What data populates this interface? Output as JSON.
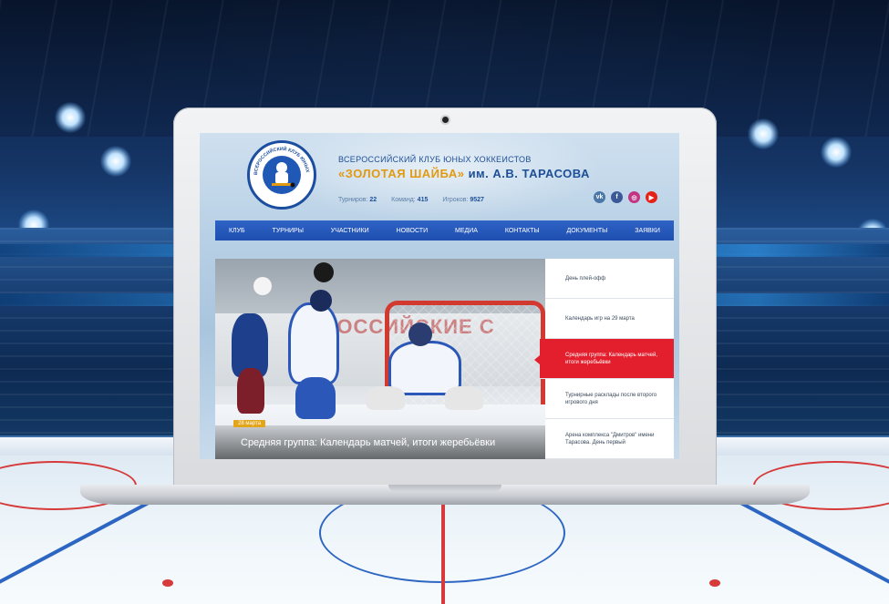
{
  "colors": {
    "nav_blue": "#2459bd",
    "brand_gold": "#e09a12",
    "brand_blue": "#1d4f97",
    "active_red": "#e31e2d",
    "date_badge": "#e3a51a"
  },
  "header": {
    "logo_text": "ВСЕРОССИЙСКИЙ КЛУБ ЮНЫХ ХОККЕИСТОВ «ЗОЛОТАЯ ШАЙБА»",
    "org_line1": "ВСЕРОССИЙСКИЙ КЛУБ ЮНЫХ ХОККЕИСТОВ",
    "org_name_quoted": "«ЗОЛОТАЯ ШАЙБА»",
    "org_name_rest": " им. А.В. ТАРАСОВА",
    "stats": [
      {
        "label": "Турниров:",
        "value": "22"
      },
      {
        "label": "Команд:",
        "value": "415"
      },
      {
        "label": "Игроков:",
        "value": "9527"
      }
    ],
    "socials": [
      {
        "name": "vk-icon",
        "glyph": "vk",
        "color": "#4a76a8"
      },
      {
        "name": "facebook-icon",
        "glyph": "f",
        "color": "#3b5998"
      },
      {
        "name": "instagram-icon",
        "glyph": "◎",
        "color": "#c13584"
      },
      {
        "name": "youtube-icon",
        "glyph": "▶",
        "color": "#e62117"
      }
    ]
  },
  "nav": {
    "items": [
      "КЛУБ",
      "ТУРНИРЫ",
      "УЧАСТНИКИ",
      "НОВОСТИ",
      "МЕДИА",
      "КОНТАКТЫ",
      "ДОКУМЕНТЫ",
      "ЗАЯВКИ"
    ]
  },
  "hero": {
    "wall_text": "РОССИЙСКИЕ С",
    "date": "28 марта",
    "title": "Средняя группа: Календарь матчей, итоги жеребьёвки"
  },
  "news": {
    "items": [
      {
        "label": "День плей-офф",
        "active": false
      },
      {
        "label": "Календарь игр на 29 марта",
        "active": false
      },
      {
        "label": "Средняя группа: Календарь матчей, итоги жеребьёвки",
        "active": true
      },
      {
        "label": "Турнирные расклады после второго игрового дня",
        "active": false
      },
      {
        "label": "Арена комплекса \"Дмитров\" имени Тарасова. День первый",
        "active": false
      }
    ]
  }
}
